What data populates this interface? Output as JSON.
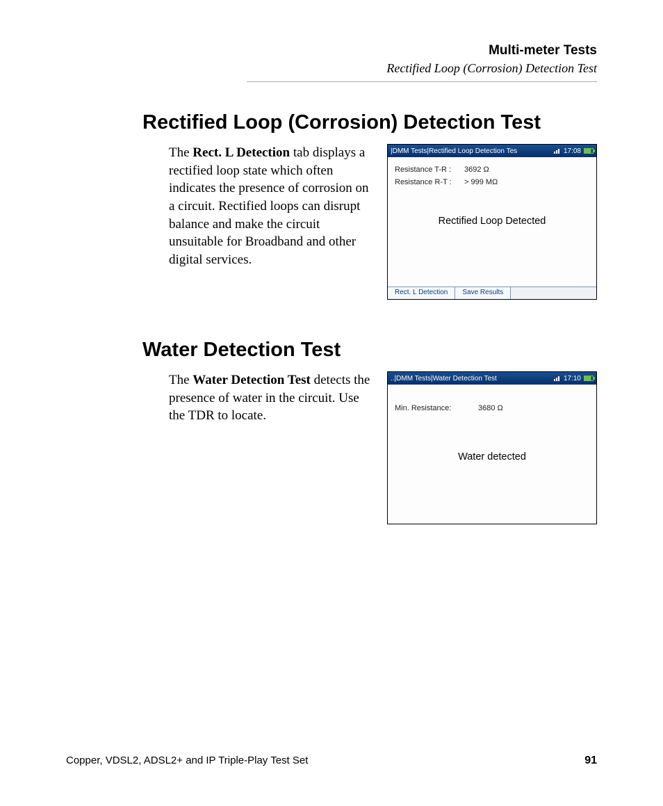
{
  "running_head": {
    "chapter": "Multi-meter Tests",
    "section": "Rectified Loop (Corrosion) Detection Test"
  },
  "section1": {
    "title": "Rectified Loop (Corrosion) Detection Test",
    "para_pre": "The ",
    "para_bold": "Rect. L Detection",
    "para_post": " tab displays a rectified loop state which often indicates the presence of corrosion on a circuit. Rectified loops can disrupt balance and make the circuit unsuitable for Broadband and other digital services.",
    "device": {
      "crumbs": "|DMM Tests|Rectified Loop Detection Tes",
      "time": "17:08",
      "rows": [
        {
          "label": "Resistance T-R :",
          "value": "3692 Ω"
        },
        {
          "label": "Resistance R-T :",
          "value": "> 999 MΩ"
        }
      ],
      "message": "Rectified Loop Detected",
      "tabs": [
        "Rect. L Detection",
        "Save Results"
      ]
    }
  },
  "section2": {
    "title": "Water Detection Test",
    "para_pre": "The ",
    "para_bold": "Water Detection Test",
    "para_post": " detects the presence of water in the circuit. Use the TDR to locate.",
    "device": {
      "crumbs": "..|DMM Tests|Water Detection Test",
      "time": "17:10",
      "rows": [
        {
          "label": "Min. Resistance:",
          "value": "3680 Ω"
        }
      ],
      "message": "Water detected",
      "tabs": []
    }
  },
  "footer": {
    "product": "Copper, VDSL2, ADSL2+ and IP Triple-Play Test Set",
    "page_number": "91"
  }
}
